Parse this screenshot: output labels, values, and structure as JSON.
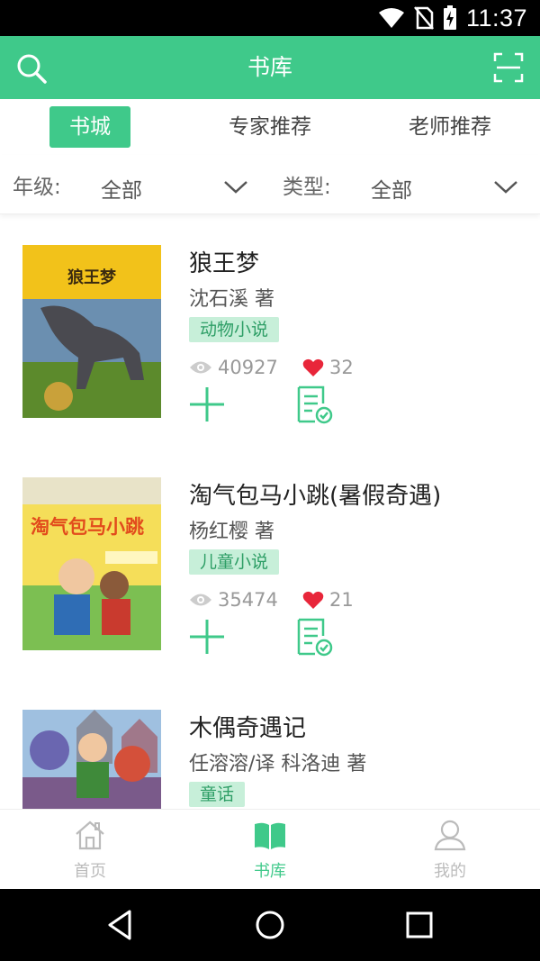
{
  "status_bar": {
    "time": "11:37"
  },
  "header": {
    "title": "书库"
  },
  "tabs": [
    {
      "label": "书城",
      "active": true
    },
    {
      "label": "专家推荐",
      "active": false
    },
    {
      "label": "老师推荐",
      "active": false
    }
  ],
  "filters": {
    "grade_label": "年级:",
    "grade_value": "全部",
    "type_label": "类型:",
    "type_value": "全部"
  },
  "books": [
    {
      "title": "狼王梦",
      "author": "沈石溪   著",
      "tag": "动物小说",
      "views": "40927",
      "likes": "32",
      "cover_title": "狼王梦"
    },
    {
      "title": "淘气包马小跳(暑假奇遇)",
      "author": "杨红樱   著",
      "tag": "儿童小说",
      "views": "35474",
      "likes": "21",
      "cover_title": "淘气包马小跳"
    },
    {
      "title": "木偶奇遇记",
      "author": "任溶溶/译 科洛迪   著",
      "tag": "童话",
      "views": "",
      "likes": "",
      "cover_title": ""
    }
  ],
  "bottom_nav": [
    {
      "label": "首页",
      "icon": "home-icon",
      "active": false
    },
    {
      "label": "书库",
      "icon": "book-icon",
      "active": true
    },
    {
      "label": "我的",
      "icon": "user-icon",
      "active": false
    }
  ],
  "colors": {
    "brand": "#3fc98a",
    "tag_bg": "#c7efd9",
    "heart": "#e8263a"
  }
}
